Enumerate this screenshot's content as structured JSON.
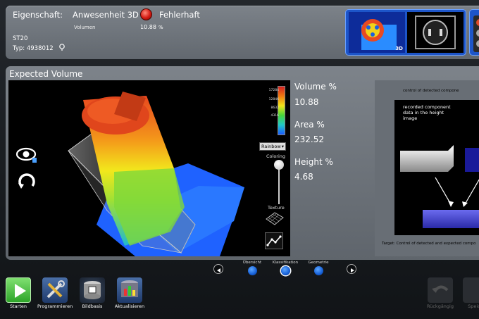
{
  "header": {
    "property_label": "Eigenschaft:",
    "property_name": "Anwesenheit 3D",
    "status_text": "Fehlerhaft",
    "volume_label": "Volumen",
    "volume_value": "10.88",
    "volume_unit": "%",
    "station": "ST20",
    "type": "Typ: 4938012",
    "thumb_badge": "3D"
  },
  "main": {
    "title": "Expected Volume",
    "viewer": {
      "scale_ticks": [
        "17284",
        "12846",
        "8632",
        "4316"
      ],
      "colormap": "Rainbow",
      "coloring_label": "Coloring",
      "texture_label": "Texture"
    },
    "stats": [
      {
        "label": "Volume %",
        "value": "10.88"
      },
      {
        "label": "Area %",
        "value": "232.52"
      },
      {
        "label": "Height %",
        "value": "4.68"
      }
    ],
    "figure": {
      "title": "control of detected compone",
      "text": "recorded component data in the height image",
      "caption": "Target: Control of detected and expected compo"
    }
  },
  "pager": {
    "items": [
      "Übersicht",
      "Klassifikation",
      "Geometrie"
    ]
  },
  "toolbar": {
    "items": [
      "Starten",
      "Programmieren",
      "Bildbasis",
      "Aktualisieren",
      "Rückgängig",
      "Speich"
    ]
  },
  "colors": {
    "status_red": "#d31a12",
    "accent_blue": "#1d55c9",
    "start_green": "#3fbf3a"
  }
}
